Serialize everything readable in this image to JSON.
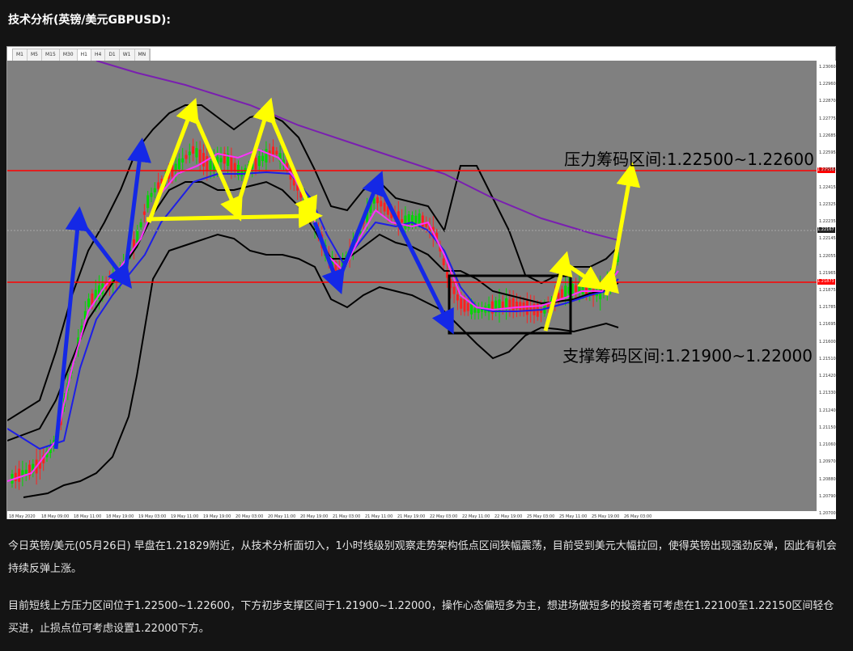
{
  "title": "技术分析(英镑/美元GBPUSD):",
  "timeframes": [
    "M1",
    "M5",
    "M15",
    "M30",
    "H1",
    "H4",
    "D1",
    "W1",
    "MN"
  ],
  "active_timeframe": "H1",
  "annotations": {
    "resistance": "压力筹码区间:1.22500~1.22600",
    "support": "支撑筹码区间:1.21900~1.22000"
  },
  "price_axis": [
    "1.23060",
    "1.22960",
    "1.22870",
    "1.22775",
    "1.22685",
    "1.22595",
    "1.22505",
    "1.22415",
    "1.22325",
    "1.22235",
    "1.22145",
    "1.22055",
    "1.21965",
    "1.21875",
    "1.21785",
    "1.21695",
    "1.21600",
    "1.21510",
    "1.21420",
    "1.21330",
    "1.21240",
    "1.21150",
    "1.21060",
    "1.20970",
    "1.20880",
    "1.20790",
    "1.20700"
  ],
  "price_tags": {
    "resistance_line": "1.22558",
    "current": "1.22167",
    "support_line": "1.21873"
  },
  "time_axis": [
    "18 May 2020",
    "18 May 09:00",
    "18 May 11:00",
    "18 May 19:00",
    "19 May 03:00",
    "19 May 11:00",
    "19 May 19:00",
    "20 May 03:00",
    "20 May 11:00",
    "20 May 19:00",
    "21 May 03:00",
    "21 May 11:00",
    "21 May 19:00",
    "22 May 03:00",
    "22 May 11:00",
    "22 May 19:00",
    "25 May 03:00",
    "25 May 11:00",
    "25 May 19:00",
    "26 May 03:00"
  ],
  "colors": {
    "plot_bg": "#808080",
    "bull_candle": "#00d800",
    "bear_candle": "#ff2020",
    "level_line": "#ff0000",
    "arrow_blue": "#1428e6",
    "arrow_yellow": "#ffff00",
    "ma_purple": "#7a1fb0",
    "bollinger": "#000000"
  },
  "paragraphs": [
    "今日英镑/美元(05月26日) 早盘在1.21829附近，从技术分析面切入，1小时线级别观察走势架构低点区间狭幅震荡，目前受到美元大幅拉回，使得英镑出现强劲反弹，因此有机会持续反弹上涨。",
    "目前短线上方压力区间位于1.22500~1.22600，下方初步支撑区间于1.21900~1.22000，操作心态偏短多为主，想进场做短多的投资者可考虑在1.22100至1.22150区间轻仓买进，止损点位可考虑设置1.22000下方。"
  ]
}
